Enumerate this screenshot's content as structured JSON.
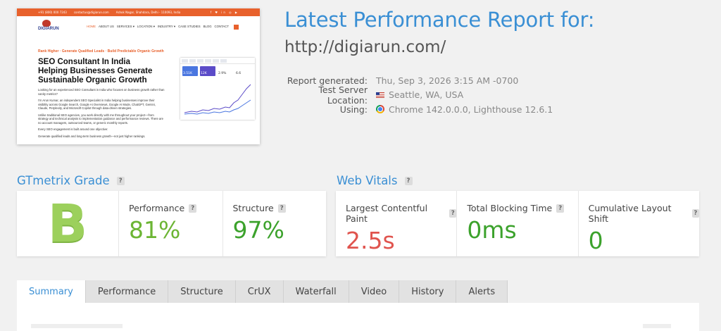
{
  "thumbnail": {
    "topbar_phone": "+91 (800) 000 7243",
    "topbar_email": "contactus@digiarun.com",
    "topbar_address": "Ashok Nagar, Shahdara, Delhi - 110093, India",
    "topbar_social": "f ♥ in ◎ ▶",
    "logo_text": "DIGIARUN",
    "menu": [
      "HOME",
      "ABOUT US",
      "SERVICES ▾",
      "LOCATION ▾",
      "INDUSTRY ▾",
      "CASE STUDIES",
      "BLOG",
      "CONTACT"
    ],
    "tagline": "Rank Higher · Generate Qualified Leads · Build Predictable Organic Growth",
    "headline": "SEO Consultant In India Helping Businesses Generate Sustainable Organic Growth",
    "para1": "Looking for an experienced SEO Consultant in India who focuses on business growth rather than vanity metrics?",
    "para2": "I'm Arun Kumar, an independent SEO Specialist in India helping businesses improve their visibility across Google Search, Google AI Overviews, Google AI Mode, ChatGPT, Gemini, Claude, Perplexity, and Microsoft Copilot through data-driven strategies.",
    "para3": "Unlike traditional SEO agencies, you work directly with me throughout your project—from strategy and technical analysis to implementation guidance and performance reviews. There are no account managers, outsourced teams, or generic monthly reports.",
    "para4": "Every SEO engagement is built around one objective:",
    "para5": "Generate qualified leads and long-term business growth—not just higher rankings.",
    "dash_tiles": [
      "3.51K",
      "12K",
      "2.9%",
      "6.6"
    ]
  },
  "header": {
    "title": "Latest Performance Report for:",
    "url": "http://digiarun.com/"
  },
  "meta": {
    "generated_label": "Report generated:",
    "generated_value": "Thu, Sep 3, 2026 3:15 AM -0700",
    "location_label": "Test Server Location:",
    "location_value": "Seattle, WA, USA",
    "using_label": "Using:",
    "using_value": "Chrome 142.0.0.0, Lighthouse 12.6.1"
  },
  "grade_section": {
    "title": "GTmetrix Grade",
    "help": "?",
    "grade": "B",
    "performance_label": "Performance",
    "performance_value": "81%",
    "structure_label": "Structure",
    "structure_value": "97%"
  },
  "vitals_section": {
    "title": "Web Vitals",
    "help": "?",
    "lcp_label": "Largest Contentful Paint",
    "lcp_value": "2.5s",
    "tbt_label": "Total Blocking Time",
    "tbt_value": "0ms",
    "cls_label": "Cumulative Layout Shift",
    "cls_value": "0"
  },
  "tabs": [
    "Summary",
    "Performance",
    "Structure",
    "CrUX",
    "Waterfall",
    "Video",
    "History",
    "Alerts"
  ],
  "active_tab": "Summary",
  "colors": {
    "accent": "#3a8fd4",
    "good": "#3ca22c",
    "bad": "#e0544e",
    "grade": "#9cd05c"
  }
}
